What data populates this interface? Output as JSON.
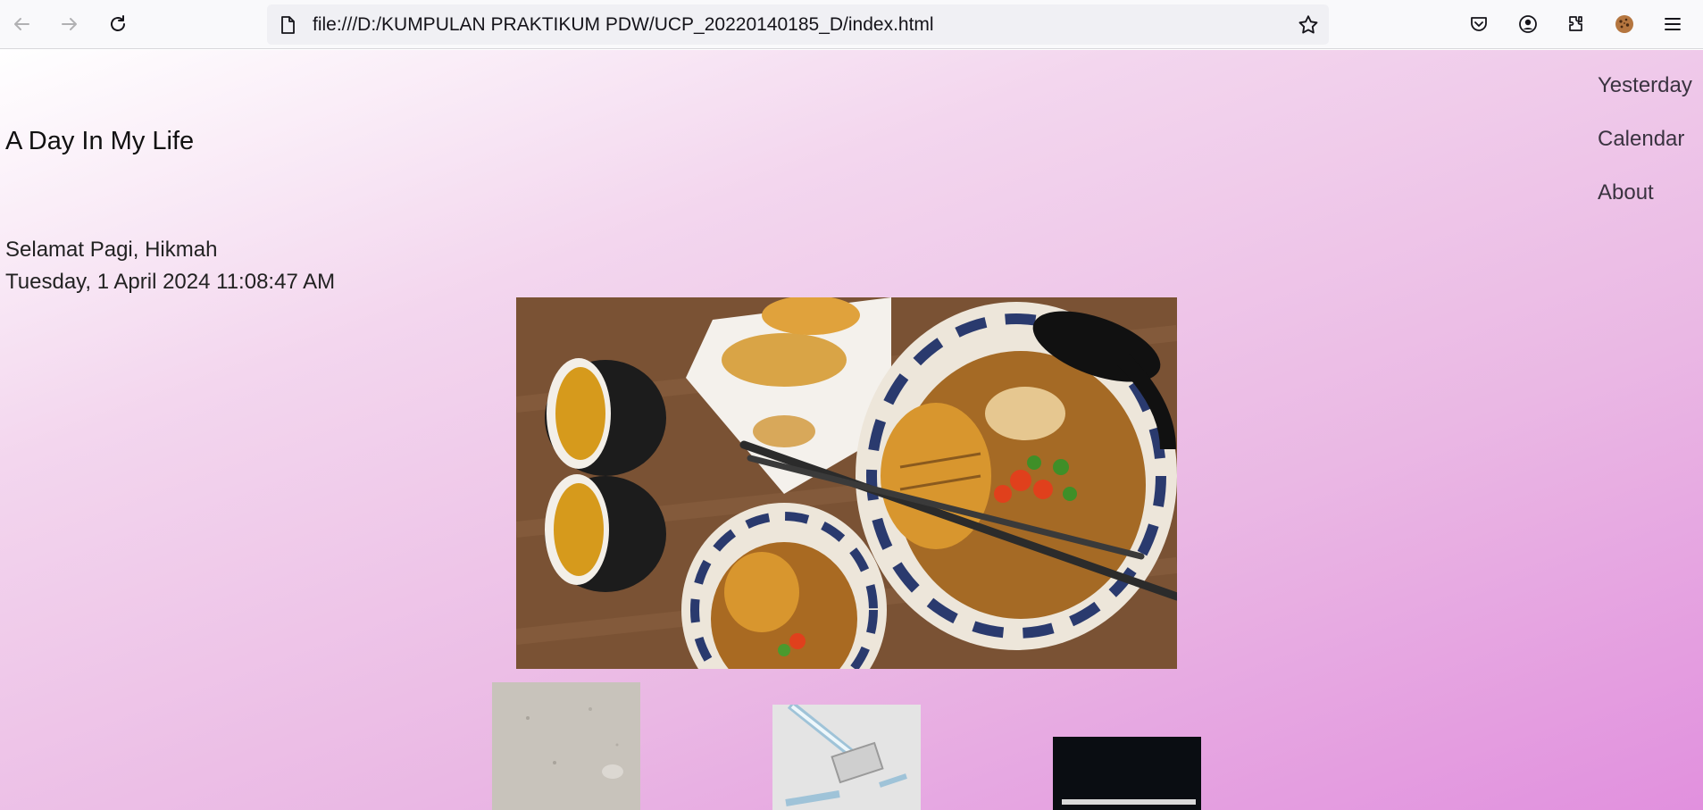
{
  "browser": {
    "url": "file:///D:/KUMPULAN PRAKTIKUM PDW/UCP_20220140185_D/index.html",
    "icons": [
      "back-icon",
      "forward-icon",
      "reload-icon",
      "page-icon",
      "bookmark-star-icon",
      "pocket-icon",
      "account-icon",
      "extensions-icon",
      "cookie-extension-icon",
      "menu-icon"
    ]
  },
  "site": {
    "title": "A Day In My Life",
    "nav": [
      "Yesterday",
      "Calendar",
      "About"
    ],
    "greeting": "Selamat Pagi, Hikmah",
    "datetime": "Tuesday, 1 April 2024 11:08:47 AM"
  },
  "colors": {
    "gradient_start": "#ffffff",
    "gradient_end": "#e190de"
  }
}
